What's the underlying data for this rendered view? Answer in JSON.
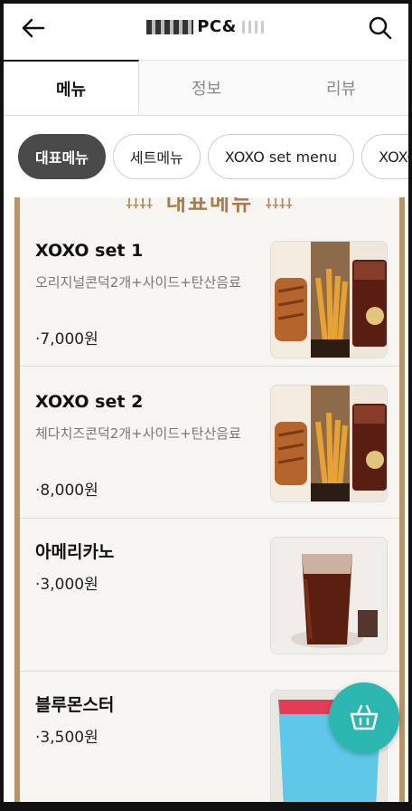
{
  "header": {
    "title": "PC&",
    "back_icon": "arrow-left-icon",
    "search_icon": "search-icon"
  },
  "tabs": [
    {
      "label": "메뉴",
      "active": true
    },
    {
      "label": "정보",
      "active": false
    },
    {
      "label": "리뷰",
      "active": false
    }
  ],
  "chips": [
    {
      "label": "대표메뉴",
      "active": true
    },
    {
      "label": "세트메뉴",
      "active": false
    },
    {
      "label": "XOXO set menu",
      "active": false
    },
    {
      "label": "XOXO",
      "active": false
    }
  ],
  "banner": {
    "text": "대표메뉴"
  },
  "menu_items": [
    {
      "name": "XOXO set 1",
      "desc": "오리지널콘덕2개+사이드+탄산음료",
      "price": "7,000원"
    },
    {
      "name": "XOXO set 2",
      "desc": "체다치즈콘덕2개+사이드+탄산음료",
      "price": "8,000원"
    },
    {
      "name": "아메리카노",
      "desc": "",
      "price": "3,000원"
    },
    {
      "name": "블루몬스터",
      "desc": "",
      "price": "3,500원"
    }
  ],
  "fab": {
    "icon": "basket-icon"
  },
  "colors": {
    "accent": "#2bb7b0",
    "panel_border": "#b89466",
    "active_chip": "#4a4a4a"
  }
}
